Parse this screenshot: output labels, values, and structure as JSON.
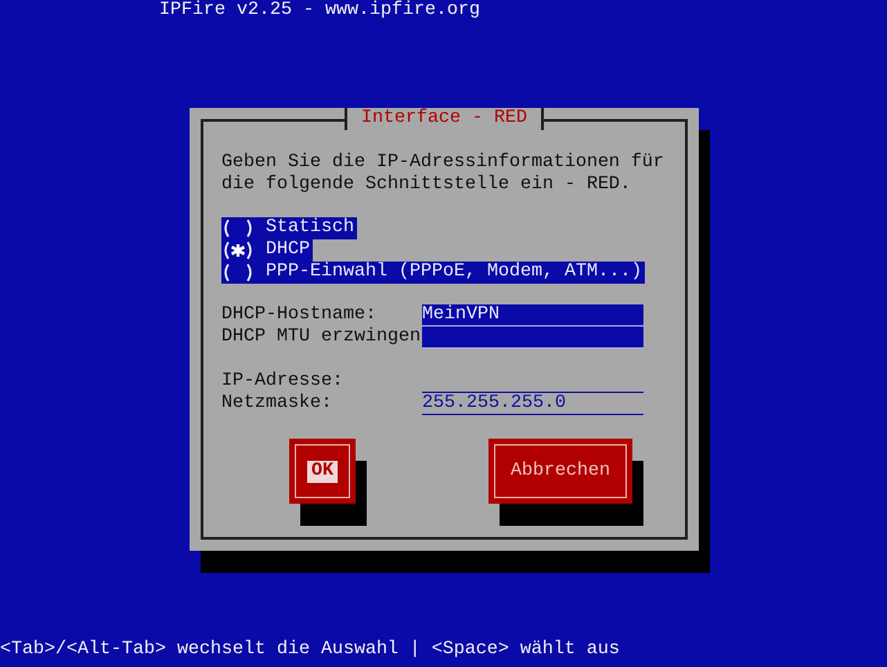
{
  "header": {
    "title": "IPFire v2.25 - www.ipfire.org"
  },
  "dialog": {
    "title": "Interface - RED",
    "message": "Geben Sie die IP-Adressinformationen für die folgende Schnittstelle ein - RED.",
    "options": [
      {
        "label": "Statisch",
        "selected": false
      },
      {
        "label": "DHCP",
        "selected": true
      },
      {
        "label": "PPP-Einwahl (PPPoE, Modem, ATM...)",
        "selected": false
      }
    ],
    "field_groups": [
      [
        {
          "label": "DHCP-Hostname:",
          "value": "MeinVPN",
          "disabled": false
        },
        {
          "label": "DHCP MTU erzwingen",
          "disabled": false
        }
      ],
      [
        {
          "label": "IP-Adresse:",
          "disabled": true
        },
        {
          "label": "Netzmaske:",
          "value": "255.255.255.0",
          "disabled": true
        }
      ]
    ],
    "buttons": [
      {
        "label": "OK",
        "focused": true
      },
      {
        "label": "Abbrechen",
        "focused": false
      }
    ]
  },
  "status_bar": {
    "text": "<Tab>/<Alt-Tab> wechselt die Auswahl | <Space> wählt aus"
  }
}
